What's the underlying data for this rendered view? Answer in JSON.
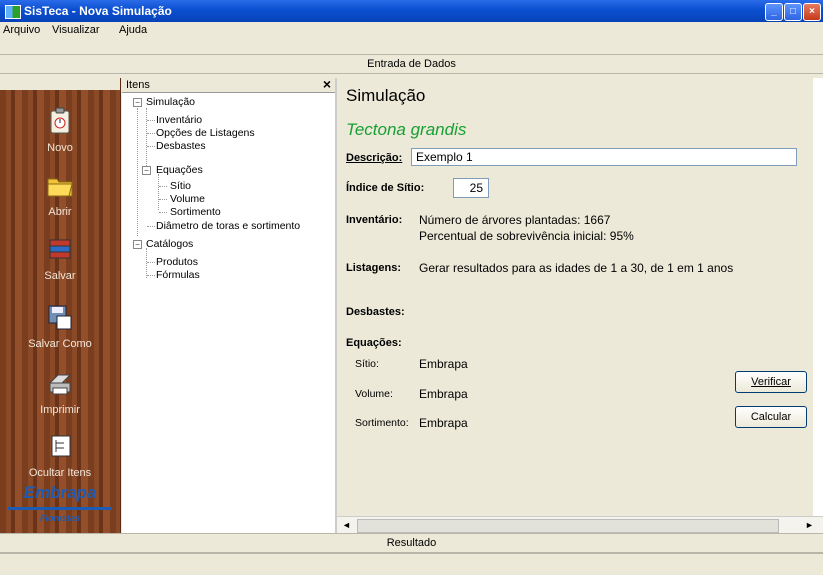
{
  "window": {
    "title": "SisTeca - Nova Simulação"
  },
  "menu": [
    "Arquivo",
    "Visualizar",
    "Ajuda"
  ],
  "sections": {
    "input": "Entrada de Dados",
    "result": "Resultado"
  },
  "toolbar": {
    "items": [
      "Novo",
      "Abrir",
      "Salvar",
      "Salvar Como",
      "Imprimir",
      "Ocultar Itens"
    ],
    "logo_text": "Embrapa",
    "logo_sub": "Florestas"
  },
  "tree": {
    "header": "Itens",
    "close": "×",
    "simulacao": "Simulação",
    "inventario": "Inventário",
    "opcoes": "Opções de Listagens",
    "desbastes": "Desbastes",
    "equacoes": "Equações",
    "sitio": "Sítio",
    "volume": "Volume",
    "sortimento": "Sortimento",
    "diametro": "Diâmetro de toras e sortimento",
    "catalogos": "Catálogos",
    "produtos": "Produtos",
    "formulas": "Fórmulas"
  },
  "main": {
    "title": "Simulação",
    "species": "Tectona grandis",
    "descricao_label": "Descrição:",
    "descricao_value": "Exemplo 1",
    "indice_label": "Índice de Sítio:",
    "indice_value": "25",
    "inventario_label": "Inventário:",
    "inventario_line1": "Número de árvores plantadas: 1667",
    "inventario_line2": "Percentual de sobrevivência inicial: 95%",
    "listagens_label": "Listagens:",
    "listagens_text": "Gerar resultados para as idades de 1 a 30, de 1 em 1 anos",
    "desbastes_label": "Desbastes:",
    "equacoes_label": "Equações:",
    "eq_sitio_label": "Sítio:",
    "eq_sitio_value": "Embrapa",
    "eq_volume_label": "Volume:",
    "eq_volume_value": "Embrapa",
    "eq_sortimento_label": "Sortimento:",
    "eq_sortimento_value": "Embrapa",
    "verificar": "Verificar",
    "calcular": "Calcular"
  },
  "colors": {
    "title_bar": "#0a4fd0",
    "species": "#18a034",
    "toolbar_wood": "#7a3d1e"
  },
  "icons": [
    "clipboard-icon",
    "folder-icon",
    "books-icon",
    "save-as-icon",
    "printer-icon",
    "hide-items-icon"
  ]
}
